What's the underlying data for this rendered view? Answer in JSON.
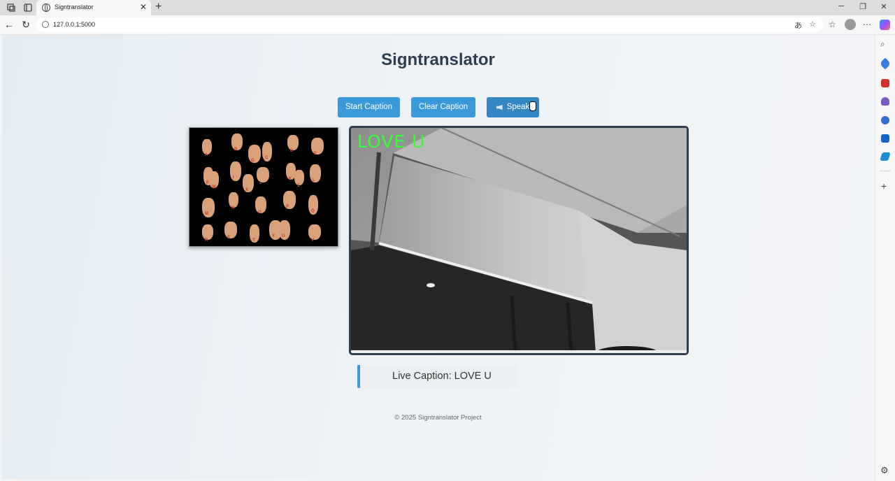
{
  "browser": {
    "tab_title": "Signtranslator",
    "url": "127.0.0.1:5000",
    "new_tab_label": "+",
    "close_tab_label": "✕",
    "window_controls": [
      "─",
      "❐",
      "✕"
    ]
  },
  "page": {
    "title": "Signtranslator",
    "buttons": {
      "start": "Start Caption",
      "clear": "Clear Caption",
      "speak": "Speak"
    },
    "sign_chart_letters": [
      "A",
      "B",
      "G",
      "C",
      "D",
      "E",
      "F",
      "I",
      "L",
      "K",
      "L",
      "M",
      "N",
      "O",
      "P",
      "Q",
      "R",
      "S",
      "T",
      "U",
      "V",
      "W",
      "X",
      "Y",
      "Z"
    ],
    "video_overlay": "LOVE U",
    "caption": "Live Caption: LOVE U",
    "footer": "© 2025 Signtranslator Project"
  },
  "colors": {
    "accent": "#3a9ad9",
    "title": "#2c3e50",
    "overlay_text": "#33ff33"
  }
}
